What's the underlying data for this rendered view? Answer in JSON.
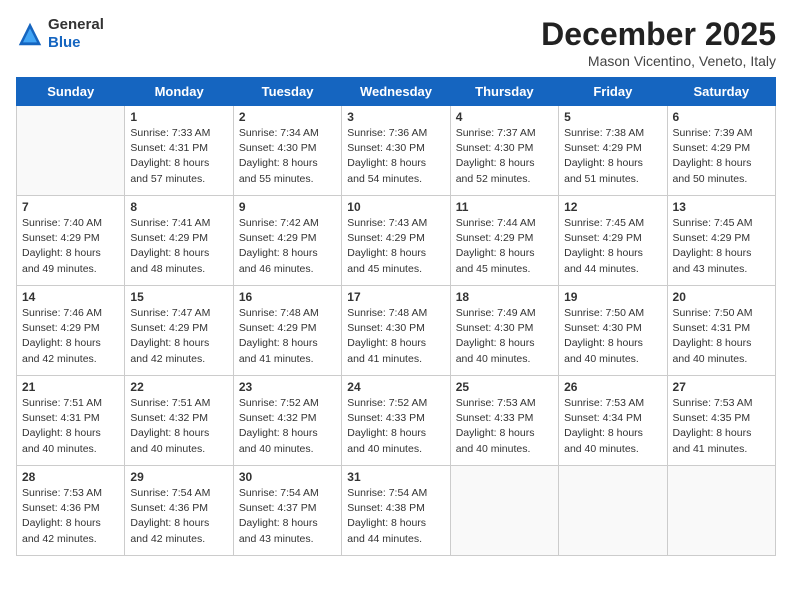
{
  "header": {
    "logo": {
      "general": "General",
      "blue": "Blue"
    },
    "title": "December 2025",
    "location": "Mason Vicentino, Veneto, Italy"
  },
  "weekdays": [
    "Sunday",
    "Monday",
    "Tuesday",
    "Wednesday",
    "Thursday",
    "Friday",
    "Saturday"
  ],
  "weeks": [
    [
      {
        "day": "",
        "sunrise": "",
        "sunset": "",
        "daylight": ""
      },
      {
        "day": "1",
        "sunrise": "Sunrise: 7:33 AM",
        "sunset": "Sunset: 4:31 PM",
        "daylight": "Daylight: 8 hours and 57 minutes."
      },
      {
        "day": "2",
        "sunrise": "Sunrise: 7:34 AM",
        "sunset": "Sunset: 4:30 PM",
        "daylight": "Daylight: 8 hours and 55 minutes."
      },
      {
        "day": "3",
        "sunrise": "Sunrise: 7:36 AM",
        "sunset": "Sunset: 4:30 PM",
        "daylight": "Daylight: 8 hours and 54 minutes."
      },
      {
        "day": "4",
        "sunrise": "Sunrise: 7:37 AM",
        "sunset": "Sunset: 4:30 PM",
        "daylight": "Daylight: 8 hours and 52 minutes."
      },
      {
        "day": "5",
        "sunrise": "Sunrise: 7:38 AM",
        "sunset": "Sunset: 4:29 PM",
        "daylight": "Daylight: 8 hours and 51 minutes."
      },
      {
        "day": "6",
        "sunrise": "Sunrise: 7:39 AM",
        "sunset": "Sunset: 4:29 PM",
        "daylight": "Daylight: 8 hours and 50 minutes."
      }
    ],
    [
      {
        "day": "7",
        "sunrise": "Sunrise: 7:40 AM",
        "sunset": "Sunset: 4:29 PM",
        "daylight": "Daylight: 8 hours and 49 minutes."
      },
      {
        "day": "8",
        "sunrise": "Sunrise: 7:41 AM",
        "sunset": "Sunset: 4:29 PM",
        "daylight": "Daylight: 8 hours and 48 minutes."
      },
      {
        "day": "9",
        "sunrise": "Sunrise: 7:42 AM",
        "sunset": "Sunset: 4:29 PM",
        "daylight": "Daylight: 8 hours and 46 minutes."
      },
      {
        "day": "10",
        "sunrise": "Sunrise: 7:43 AM",
        "sunset": "Sunset: 4:29 PM",
        "daylight": "Daylight: 8 hours and 45 minutes."
      },
      {
        "day": "11",
        "sunrise": "Sunrise: 7:44 AM",
        "sunset": "Sunset: 4:29 PM",
        "daylight": "Daylight: 8 hours and 45 minutes."
      },
      {
        "day": "12",
        "sunrise": "Sunrise: 7:45 AM",
        "sunset": "Sunset: 4:29 PM",
        "daylight": "Daylight: 8 hours and 44 minutes."
      },
      {
        "day": "13",
        "sunrise": "Sunrise: 7:45 AM",
        "sunset": "Sunset: 4:29 PM",
        "daylight": "Daylight: 8 hours and 43 minutes."
      }
    ],
    [
      {
        "day": "14",
        "sunrise": "Sunrise: 7:46 AM",
        "sunset": "Sunset: 4:29 PM",
        "daylight": "Daylight: 8 hours and 42 minutes."
      },
      {
        "day": "15",
        "sunrise": "Sunrise: 7:47 AM",
        "sunset": "Sunset: 4:29 PM",
        "daylight": "Daylight: 8 hours and 42 minutes."
      },
      {
        "day": "16",
        "sunrise": "Sunrise: 7:48 AM",
        "sunset": "Sunset: 4:29 PM",
        "daylight": "Daylight: 8 hours and 41 minutes."
      },
      {
        "day": "17",
        "sunrise": "Sunrise: 7:48 AM",
        "sunset": "Sunset: 4:30 PM",
        "daylight": "Daylight: 8 hours and 41 minutes."
      },
      {
        "day": "18",
        "sunrise": "Sunrise: 7:49 AM",
        "sunset": "Sunset: 4:30 PM",
        "daylight": "Daylight: 8 hours and 40 minutes."
      },
      {
        "day": "19",
        "sunrise": "Sunrise: 7:50 AM",
        "sunset": "Sunset: 4:30 PM",
        "daylight": "Daylight: 8 hours and 40 minutes."
      },
      {
        "day": "20",
        "sunrise": "Sunrise: 7:50 AM",
        "sunset": "Sunset: 4:31 PM",
        "daylight": "Daylight: 8 hours and 40 minutes."
      }
    ],
    [
      {
        "day": "21",
        "sunrise": "Sunrise: 7:51 AM",
        "sunset": "Sunset: 4:31 PM",
        "daylight": "Daylight: 8 hours and 40 minutes."
      },
      {
        "day": "22",
        "sunrise": "Sunrise: 7:51 AM",
        "sunset": "Sunset: 4:32 PM",
        "daylight": "Daylight: 8 hours and 40 minutes."
      },
      {
        "day": "23",
        "sunrise": "Sunrise: 7:52 AM",
        "sunset": "Sunset: 4:32 PM",
        "daylight": "Daylight: 8 hours and 40 minutes."
      },
      {
        "day": "24",
        "sunrise": "Sunrise: 7:52 AM",
        "sunset": "Sunset: 4:33 PM",
        "daylight": "Daylight: 8 hours and 40 minutes."
      },
      {
        "day": "25",
        "sunrise": "Sunrise: 7:53 AM",
        "sunset": "Sunset: 4:33 PM",
        "daylight": "Daylight: 8 hours and 40 minutes."
      },
      {
        "day": "26",
        "sunrise": "Sunrise: 7:53 AM",
        "sunset": "Sunset: 4:34 PM",
        "daylight": "Daylight: 8 hours and 40 minutes."
      },
      {
        "day": "27",
        "sunrise": "Sunrise: 7:53 AM",
        "sunset": "Sunset: 4:35 PM",
        "daylight": "Daylight: 8 hours and 41 minutes."
      }
    ],
    [
      {
        "day": "28",
        "sunrise": "Sunrise: 7:53 AM",
        "sunset": "Sunset: 4:36 PM",
        "daylight": "Daylight: 8 hours and 42 minutes."
      },
      {
        "day": "29",
        "sunrise": "Sunrise: 7:54 AM",
        "sunset": "Sunset: 4:36 PM",
        "daylight": "Daylight: 8 hours and 42 minutes."
      },
      {
        "day": "30",
        "sunrise": "Sunrise: 7:54 AM",
        "sunset": "Sunset: 4:37 PM",
        "daylight": "Daylight: 8 hours and 43 minutes."
      },
      {
        "day": "31",
        "sunrise": "Sunrise: 7:54 AM",
        "sunset": "Sunset: 4:38 PM",
        "daylight": "Daylight: 8 hours and 44 minutes."
      },
      {
        "day": "",
        "sunrise": "",
        "sunset": "",
        "daylight": ""
      },
      {
        "day": "",
        "sunrise": "",
        "sunset": "",
        "daylight": ""
      },
      {
        "day": "",
        "sunrise": "",
        "sunset": "",
        "daylight": ""
      }
    ]
  ]
}
